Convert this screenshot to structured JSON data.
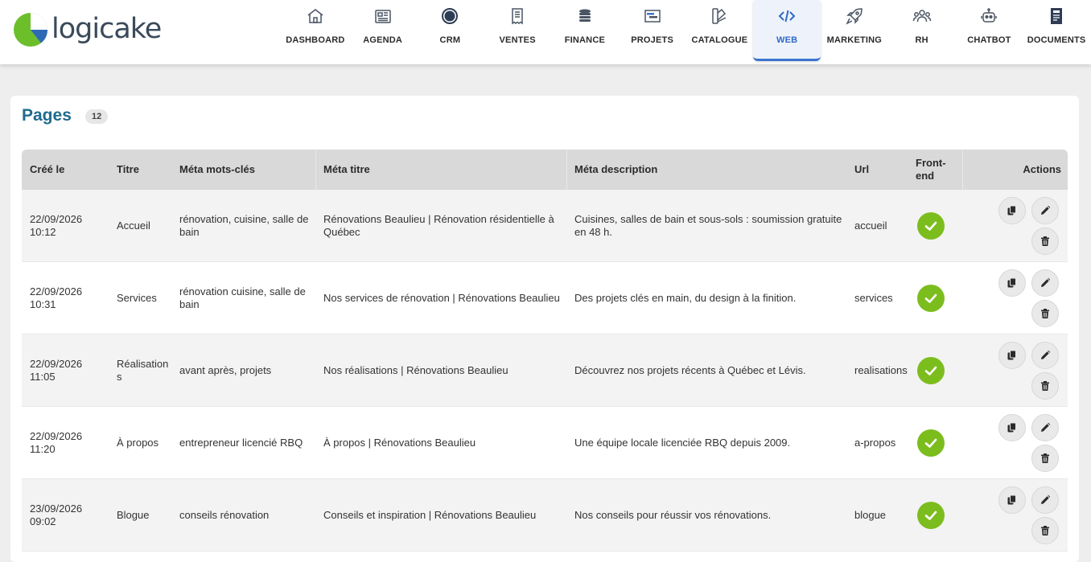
{
  "app": {
    "logo_text": "logicake"
  },
  "nav": [
    {
      "label": "DASHBOARD",
      "icon": "home-icon"
    },
    {
      "label": "AGENDA",
      "icon": "newspaper-icon"
    },
    {
      "label": "CRM",
      "icon": "target-icon"
    },
    {
      "label": "VENTES",
      "icon": "receipt-icon"
    },
    {
      "label": "FINANCE",
      "icon": "coins-icon"
    },
    {
      "label": "PROJETS",
      "icon": "gantt-icon"
    },
    {
      "label": "CATALOGUE",
      "icon": "swatch-book-icon"
    },
    {
      "label": "WEB",
      "icon": "code-icon",
      "active": true
    },
    {
      "label": "MARKETING",
      "icon": "rocket-icon"
    },
    {
      "label": "RH",
      "icon": "users-icon"
    },
    {
      "label": "CHATBOT",
      "icon": "robot-icon"
    },
    {
      "label": "DOCUMENTS",
      "icon": "document-icon"
    }
  ],
  "page": {
    "title": "Pages",
    "count": "12"
  },
  "table": {
    "headers": {
      "created": "Créé le",
      "title": "Titre",
      "meta_keywords": "Méta mots-clés",
      "meta_title": "Méta titre",
      "meta_description": "Méta description",
      "url": "Url",
      "frontend_line1": "Front-",
      "frontend_line2": "end",
      "actions": "Actions"
    },
    "rows": [
      {
        "date": "22/09/2026",
        "time": "10:12",
        "title": "Accueil",
        "keywords": "rénovation, cuisine, salle de bain",
        "meta_title": "Rénovations Beaulieu | Rénovation résidentielle à Québec",
        "meta_description": "Cuisines, salles de bain et sous-sols : soumission gratuite en 48 h.",
        "url": "accueil",
        "frontend": true
      },
      {
        "date": "22/09/2026",
        "time": "10:31",
        "title": "Services",
        "keywords": "rénovation cuisine, salle de bain",
        "meta_title": "Nos services de rénovation | Rénovations Beaulieu",
        "meta_description": "Des projets clés en main, du design à la finition.",
        "url": "services",
        "frontend": true
      },
      {
        "date": "22/09/2026",
        "time": "11:05",
        "title": "Réalisations",
        "keywords": "avant après, projets",
        "meta_title": "Nos réalisations | Rénovations Beaulieu",
        "meta_description": "Découvrez nos projets récents à Québec et Lévis.",
        "url": "realisations",
        "frontend": true
      },
      {
        "date": "22/09/2026",
        "time": "11:20",
        "title": "À propos",
        "keywords": "entrepreneur licencié RBQ",
        "meta_title": "À propos | Rénovations Beaulieu",
        "meta_description": "Une équipe locale licenciée RBQ depuis 2009.",
        "url": "a-propos",
        "frontend": true
      },
      {
        "date": "23/09/2026",
        "time": "09:02",
        "title": "Blogue",
        "keywords": "conseils rénovation",
        "meta_title": "Conseils et inspiration | Rénovations Beaulieu",
        "meta_description": "Nos conseils pour réussir vos rénovations.",
        "url": "blogue",
        "frontend": true
      }
    ]
  },
  "colors": {
    "accent": "#1f6b8e",
    "active_nav": "#2f69c8",
    "check": "#7cbd1e",
    "logo_green": "#6cbf2b",
    "logo_blue": "#2f6ab5"
  }
}
